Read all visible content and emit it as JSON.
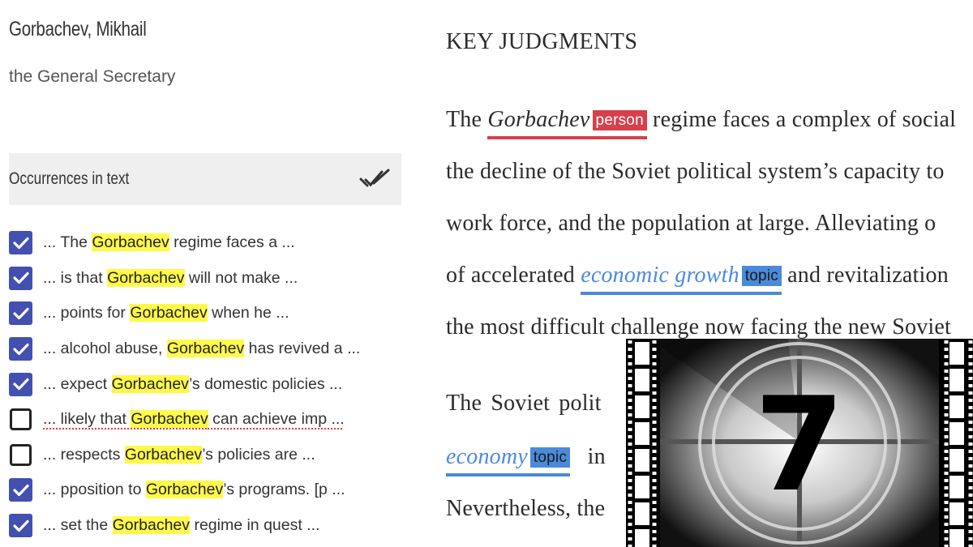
{
  "entity": {
    "name": "Gorbachev, Mikhail",
    "description": "the General Secretary"
  },
  "occurrences": {
    "title": "Occurrences in text",
    "check_all_icon": "double-check-icon",
    "items": [
      {
        "checked": true,
        "before": "... The ",
        "match": "Gorbachev",
        "after": " regime faces a ...",
        "spell_flag": false
      },
      {
        "checked": true,
        "before": "... is that ",
        "match": "Gorbachev",
        "after": " will not make ...",
        "spell_flag": false
      },
      {
        "checked": true,
        "before": "... points for ",
        "match": "Gorbachev",
        "after": " when he ...",
        "spell_flag": false
      },
      {
        "checked": true,
        "before": "... alcohol abuse, ",
        "match": "Gorbachev",
        "after": " has revived a ...",
        "spell_flag": false
      },
      {
        "checked": true,
        "before": "... expect ",
        "match": "Gorbachev",
        "after": "’s domestic policies ...",
        "spell_flag": false
      },
      {
        "checked": false,
        "before": "... likely that ",
        "match": "Gorbachev",
        "after": " can achieve imp ...",
        "spell_flag": true
      },
      {
        "checked": false,
        "before": "... respects ",
        "match": "Gorbachev",
        "after": "’s policies are ...",
        "spell_flag": false
      },
      {
        "checked": true,
        "before": "... pposition to ",
        "match": "Gorbachev",
        "after": "’s programs. [p ...",
        "spell_flag": false
      },
      {
        "checked": true,
        "before": "... set the ",
        "match": "Gorbachev",
        "after": " regime in quest ...",
        "spell_flag": false
      }
    ]
  },
  "document": {
    "heading": "KEY JUDGMENTS",
    "p1": {
      "l1_a": "The ",
      "l1_entity": "Gorbachev",
      "l1_tag": "person",
      "l1_b": " regime faces a complex of social",
      "l2": "the decline of the Soviet political system’s capacity to",
      "l3": "work force, and the population at large. Alleviating o",
      "l4_a": "of accelerated ",
      "l4_entity": "economic growth",
      "l4_tag": "topic",
      "l4_b": " and revitalization",
      "l5": "the most difficult challenge now facing the new Soviet"
    },
    "p2": {
      "l1": "The  Soviet  polit",
      "l2_entity": "economy",
      "l2_tag": "topic",
      "l2_b": "   in",
      "l3": "Nevertheless, the"
    }
  },
  "overlay": {
    "type": "film-countdown-image",
    "number": "7"
  },
  "colors": {
    "checkbox_on": "#4350b0",
    "highlight": "#fff94a",
    "person_tag": "#d5404c",
    "topic_tag": "#4a8ad8",
    "topic_text": "#4a8ae0",
    "header_bg": "#efefef"
  }
}
